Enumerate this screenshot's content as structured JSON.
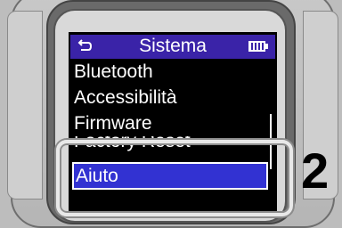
{
  "header": {
    "title": "Sistema",
    "back_icon": "back-arrow-icon",
    "battery_icon": "battery-icon"
  },
  "menu": {
    "items": [
      {
        "label": "Bluetooth"
      },
      {
        "label": "Accessibilità"
      },
      {
        "label": "Firmware"
      },
      {
        "label": "Factory Reset"
      },
      {
        "label": "Aiuto",
        "selected": true
      }
    ]
  },
  "callout": {
    "step": "2"
  },
  "colors": {
    "header_bg": "#3a23a8",
    "selection_bg": "#3232d2"
  }
}
